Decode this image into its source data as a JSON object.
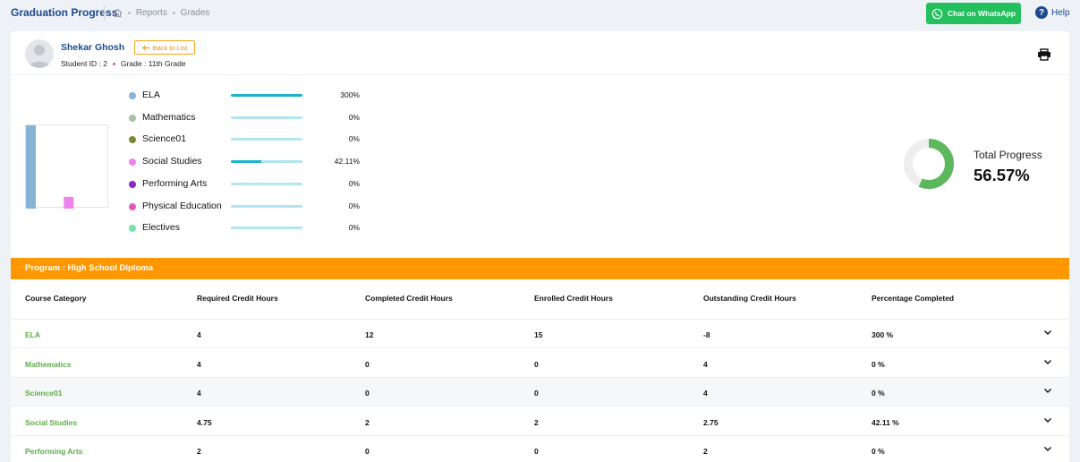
{
  "header": {
    "title": "Graduation Progress",
    "breadcrumb": [
      "Reports",
      "Grades"
    ],
    "whatsapp_label": "Chat on WhatsApp",
    "help_label": "Help"
  },
  "student": {
    "name": "Shekar Ghosh",
    "back_label": "Back to List",
    "id_text": "Student ID : 2",
    "grade_text": "Grade : 11th Grade"
  },
  "subjects": [
    {
      "name": "ELA",
      "percent_text": "300%",
      "progress": 1.0,
      "color": "#86b3d6"
    },
    {
      "name": "Mathematics",
      "percent_text": "0%",
      "progress": 0,
      "color": "#a6c4a0"
    },
    {
      "name": "Science01",
      "percent_text": "0%",
      "progress": 0,
      "color": "#7b8a2e"
    },
    {
      "name": "Social Studies",
      "percent_text": "42.11%",
      "progress": 0.4211,
      "color": "#ee82ee"
    },
    {
      "name": "Performing Arts",
      "percent_text": "0%",
      "progress": 0,
      "color": "#8a2bc2"
    },
    {
      "name": "Physical Education",
      "percent_text": "0%",
      "progress": 0,
      "color": "#e05ab8"
    },
    {
      "name": "Electives",
      "percent_text": "0%",
      "progress": 0,
      "color": "#6ee7a8"
    }
  ],
  "mini_chart_values": [
    300,
    0,
    0,
    42.11,
    0,
    0,
    0
  ],
  "total_progress": {
    "label": "Total Progress",
    "value_text": "56.57%",
    "value": 0.5657,
    "color": "#5cb85c",
    "track_color": "#eeeeee"
  },
  "program": {
    "label": "Program : High School Diploma"
  },
  "table": {
    "headers": [
      "Course Category",
      "Required Credit Hours",
      "Completed Credit Hours",
      "Enrolled Credit Hours",
      "Outstanding Credit Hours",
      "Percentage Completed"
    ],
    "rows": [
      [
        "ELA",
        "4",
        "12",
        "15",
        "-8",
        "300 %"
      ],
      [
        "Mathematics",
        "4",
        "0",
        "0",
        "4",
        "0 %"
      ],
      [
        "Science01",
        "4",
        "0",
        "0",
        "4",
        "0 %"
      ],
      [
        "Social Studies",
        "4.75",
        "2",
        "2",
        "2.75",
        "42.11 %"
      ],
      [
        "Performing Arts",
        "2",
        "0",
        "0",
        "2",
        "0 %"
      ]
    ]
  },
  "icons": {
    "home": "home-icon",
    "whatsapp": "whatsapp-icon",
    "help": "help-icon",
    "back": "arrow-left-icon",
    "print": "print-icon",
    "expand": "chevron-down-icon"
  }
}
